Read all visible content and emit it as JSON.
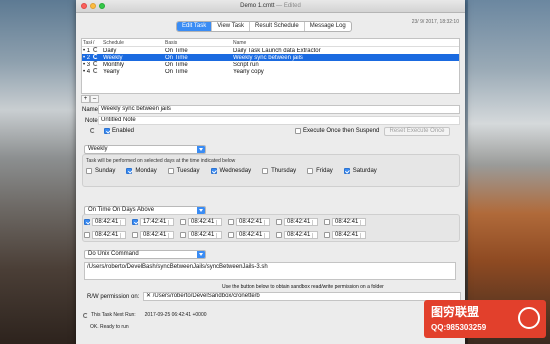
{
  "window": {
    "title": "Demo 1.crntt",
    "title_edited": "— Edited",
    "datetime": "23/ 9/ 2017, 18:32:10"
  },
  "tabs": [
    "Edit Task",
    "View Task",
    "Result Schedule",
    "Message Log"
  ],
  "table": {
    "headers": [
      "Task",
      "/",
      "Schedule",
      "Basis",
      "Name"
    ],
    "rows": [
      {
        "task": "1",
        "schedule": "Daily",
        "basis": "On Time",
        "name": "Daily Task Launch data Extractor"
      },
      {
        "task": "2",
        "schedule": "Weekly",
        "basis": "On Time",
        "name": "Weekly sync between jails"
      },
      {
        "task": "3",
        "schedule": "Monthly",
        "basis": "On Time",
        "name": "Script run"
      },
      {
        "task": "4",
        "schedule": "Yearly",
        "basis": "On Time",
        "name": "Yearly copy"
      }
    ]
  },
  "add_label": "+",
  "remove_label": "–",
  "form": {
    "name_label": "Name:",
    "name_value": "Weekly sync between jails",
    "note_label": "Note:",
    "note_value": "Untitled Note",
    "enabled_label": "Enabled",
    "execute_once_label": "Execute Once then Suspend",
    "reset_button": "Reset Execute Once"
  },
  "schedule": {
    "popup": "Weekly",
    "desc": "Task will be performed on selected days at the time indicated below",
    "days": [
      {
        "label": "Sunday",
        "checked": false
      },
      {
        "label": "Monday",
        "checked": true
      },
      {
        "label": "Tuesday",
        "checked": false
      },
      {
        "label": "Wednesday",
        "checked": true
      },
      {
        "label": "Thursday",
        "checked": false
      },
      {
        "label": "Friday",
        "checked": false
      },
      {
        "label": "Saturday",
        "checked": true
      }
    ]
  },
  "basis": {
    "popup": "On Time On Days Above",
    "row1": [
      {
        "time": "08:42:41",
        "checked": true
      },
      {
        "time": "17:42:41",
        "checked": true
      },
      {
        "time": "08:42:41",
        "checked": false
      },
      {
        "time": "08:42:41",
        "checked": false
      },
      {
        "time": "08:42:41",
        "checked": false
      },
      {
        "time": "08:42:41",
        "checked": false
      }
    ],
    "row2": [
      {
        "time": "08:42:41",
        "checked": false
      },
      {
        "time": "08:42:41",
        "checked": false
      },
      {
        "time": "08:42:41",
        "checked": false
      },
      {
        "time": "08:42:41",
        "checked": false
      },
      {
        "time": "08:42:41",
        "checked": false
      },
      {
        "time": "08:42:41",
        "checked": false
      }
    ]
  },
  "command": {
    "popup": "Do Unix Command",
    "path": "/Users/roberto/DevelBash/syncBetweenJails/syncBetweenJails-3.sh",
    "hint": "Use the button below to obtain sandbox read/write permission on a folder",
    "rw_label": "R/W permission on:",
    "rw_value": "/Users/roberto/DevelSandbox/cronette/b"
  },
  "status": {
    "next_run_label": "This Task Next Run:",
    "next_run_value": "2017-09-25 06:42:41 +0000",
    "ready": "OK. Ready to run"
  },
  "watermark": {
    "line1": "图穷联盟",
    "line2": "QQ:985303259"
  }
}
